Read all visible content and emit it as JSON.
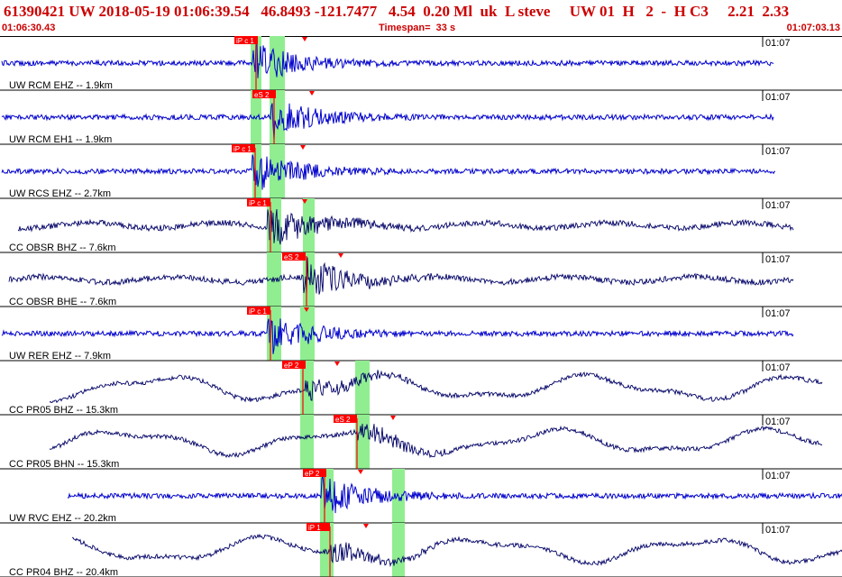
{
  "header": {
    "title": "61390421 UW 2018-05-19 01:06:39.54   46.8493 -121.7477   4.54  0.20 Ml  uk  L steve     UW 01  H   2  -  H C3     2.21  2.33",
    "start_time": "01:06:30.43",
    "timespan": "Timespan=  33 s",
    "end_time": "01:07:03.13"
  },
  "colors": {
    "blue_trace": "#0000cc",
    "dark_trace": "#000066",
    "pick_window": "#90ee90",
    "pick_marker": "#ff0000",
    "header_text": "#cc0000"
  },
  "traces": [
    {
      "label": "UW RCM EHZ -- 1.9km",
      "time_tick": "01:07",
      "color": "blue",
      "pick": "iP c 1",
      "pick2": "",
      "onset": 0.33
    },
    {
      "label": "UW RCM EH1 -- 1.9km",
      "time_tick": "01:07",
      "color": "blue",
      "pick": "eS 2",
      "pick2": "",
      "onset": 0.33
    },
    {
      "label": "UW RCS EHZ -- 2.7km",
      "time_tick": "01:07",
      "color": "blue",
      "pick": "iP c 1",
      "pick2": "",
      "onset": 0.32
    },
    {
      "label": "CC OBSR BHZ -- 7.6km",
      "time_tick": "01:07",
      "color": "dark",
      "pick": "iP c 1",
      "pick2": "",
      "onset": 0.38
    },
    {
      "label": "CC OBSR BHE -- 7.6km",
      "time_tick": "01:07",
      "color": "dark",
      "pick": "eS 2",
      "pick2": "",
      "onset": 0.38
    },
    {
      "label": "UW RER EHZ -- 7.9km",
      "time_tick": "01:07",
      "color": "blue",
      "pick": "iP c 1",
      "pick2": "",
      "onset": 0.35
    },
    {
      "label": "CC PR05 BHZ -- 15.3km",
      "time_tick": "01:07",
      "color": "dark",
      "pick": "eP 2",
      "pick2": "",
      "onset": 0.38
    },
    {
      "label": "CC PR05 BHN -- 15.3km",
      "time_tick": "01:07",
      "color": "dark",
      "pick": "eS 2",
      "pick2": "",
      "onset": 0.43
    },
    {
      "label": "UW RVC EHZ -- 20.2km",
      "time_tick": "01:07",
      "color": "blue",
      "pick": "eP 2",
      "pick2": "",
      "onset": 0.39
    },
    {
      "label": "CC PR04 BHZ -- 20.4km",
      "time_tick": "01:07",
      "color": "dark",
      "pick": "iP 1",
      "pick2": "",
      "onset": 0.4
    }
  ]
}
